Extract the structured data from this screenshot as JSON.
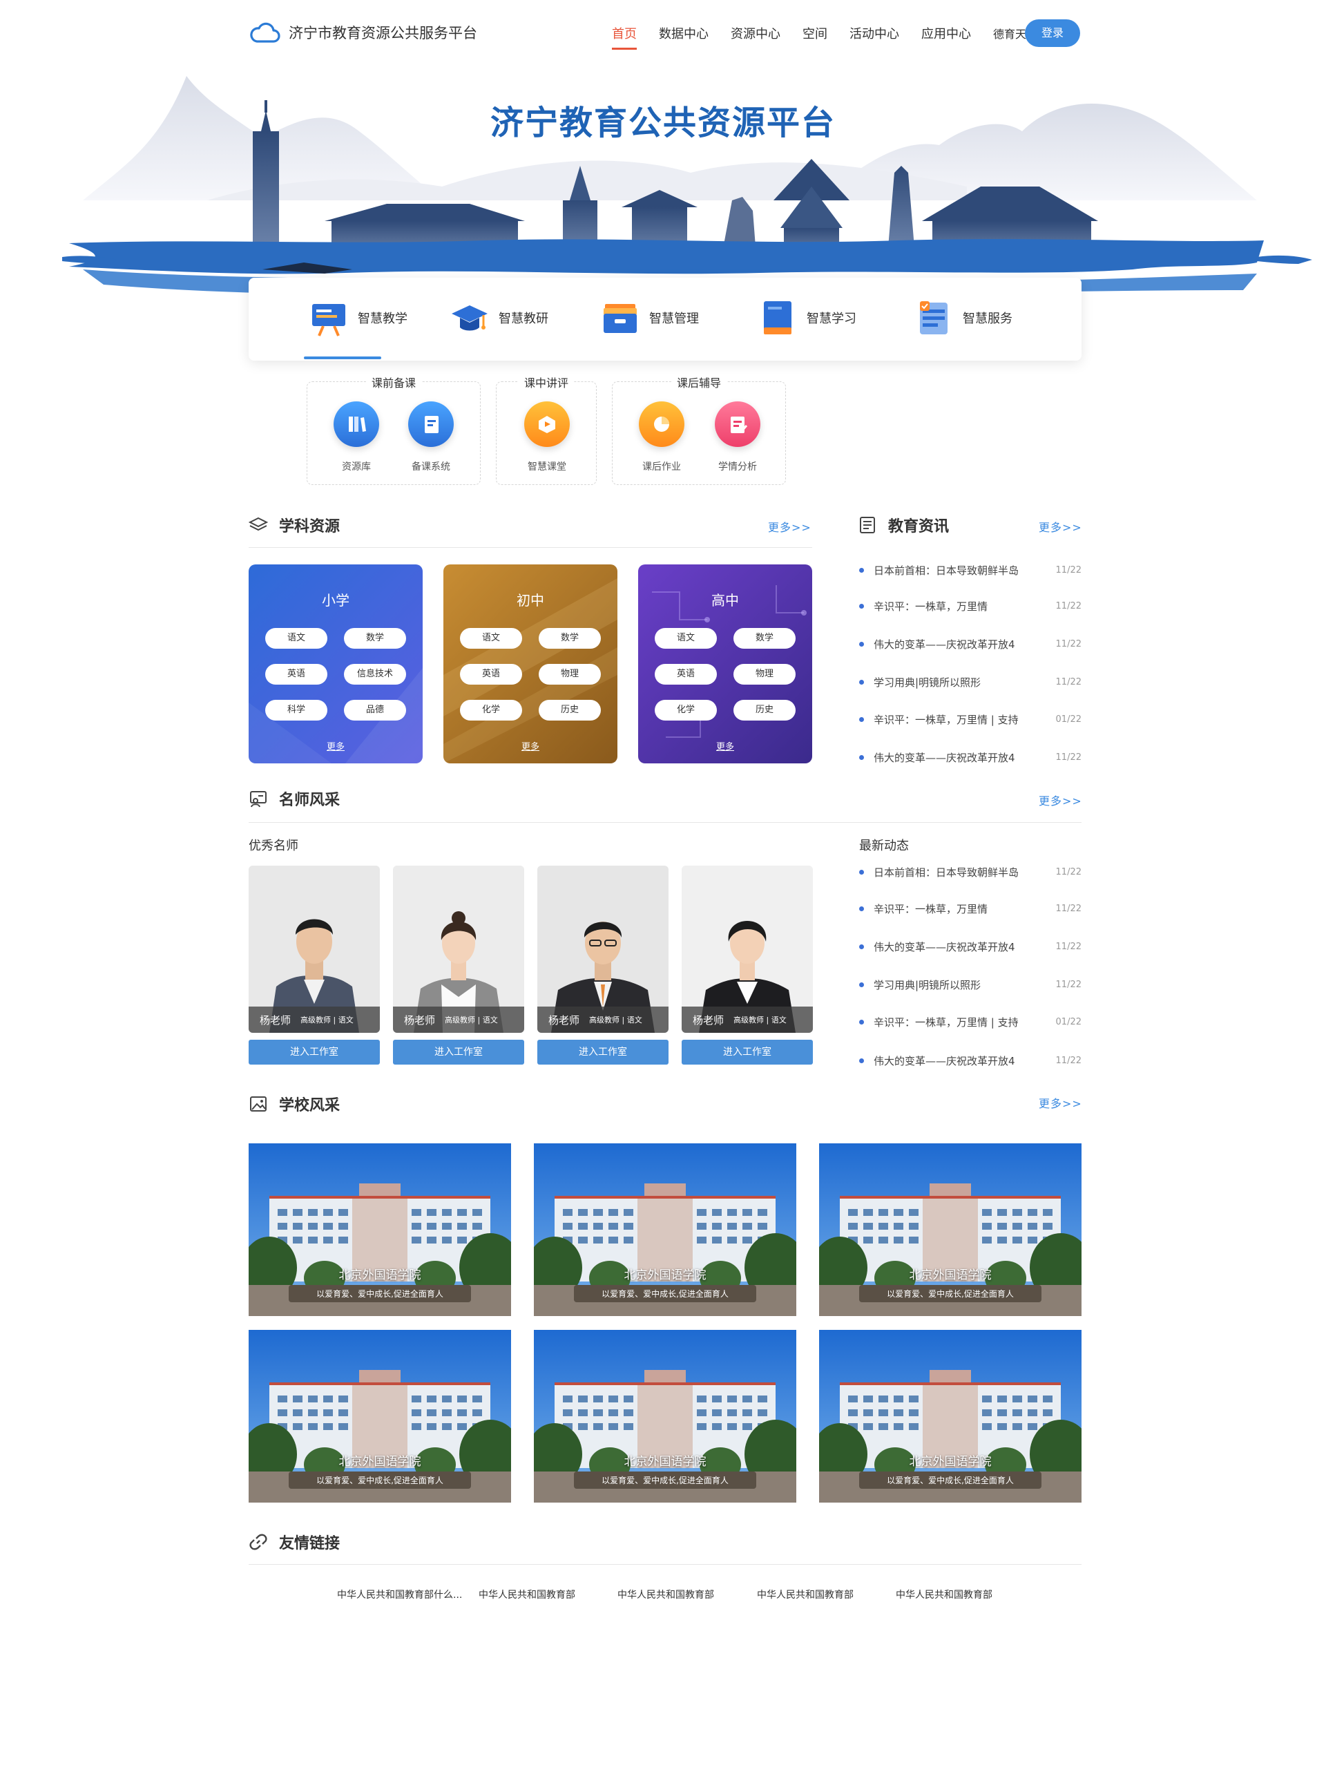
{
  "header": {
    "site_title": "济宁市教育资源公共服务平台",
    "nav": [
      "首页",
      "数据中心",
      "资源中心",
      "空间",
      "活动中心",
      "应用中心",
      "德育天地"
    ],
    "login": "登录"
  },
  "banner": {
    "title": "济宁教育公共资源平台"
  },
  "features": [
    {
      "label": "智慧教学",
      "icon": "easel-icon"
    },
    {
      "label": "智慧教研",
      "icon": "graduation-cap-icon"
    },
    {
      "label": "智慧管理",
      "icon": "briefcase-icon"
    },
    {
      "label": "智慧学习",
      "icon": "book-icon"
    },
    {
      "label": "智慧服务",
      "icon": "clipboard-icon"
    }
  ],
  "sub_features": [
    {
      "title": "课前备课",
      "items": [
        {
          "label": "资源库",
          "icon": "books-icon"
        },
        {
          "label": "备课系统",
          "icon": "notebook-icon"
        }
      ]
    },
    {
      "title": "课中讲评",
      "items": [
        {
          "label": "智慧课堂",
          "icon": "cube-icon"
        }
      ]
    },
    {
      "title": "课后辅导",
      "items": [
        {
          "label": "课后作业",
          "icon": "pie-icon"
        },
        {
          "label": "学情分析",
          "icon": "checklist-icon"
        }
      ]
    }
  ],
  "subjects": {
    "title": "学科资源",
    "more": "更多>>",
    "cards": [
      {
        "title": "小学",
        "subjects": [
          "语文",
          "数学",
          "英语",
          "信息技术",
          "科学",
          "品德"
        ],
        "more": "更多"
      },
      {
        "title": "初中",
        "subjects": [
          "语文",
          "数学",
          "英语",
          "物理",
          "化学",
          "历史"
        ],
        "more": "更多"
      },
      {
        "title": "高中",
        "subjects": [
          "语文",
          "数学",
          "英语",
          "物理",
          "化学",
          "历史"
        ],
        "more": "更多"
      }
    ]
  },
  "edu_news": {
    "title": "教育资讯",
    "more": "更多>>",
    "items": [
      {
        "text": "日本前首相：日本导致朝鲜半岛",
        "date": "11/22"
      },
      {
        "text": "辛识平：一株草，万里情",
        "date": "11/22"
      },
      {
        "text": "伟大的变革——庆祝改革开放4",
        "date": "11/22"
      },
      {
        "text": "学习用典|明镜所以照形",
        "date": "11/22"
      },
      {
        "text": "辛识平：一株草，万里情 | 支持",
        "date": "01/22"
      },
      {
        "text": "伟大的变革——庆祝改革开放4",
        "date": "11/22"
      }
    ]
  },
  "teachers": {
    "title": "名师风采",
    "more": "更多>>",
    "subtitle": "优秀名师",
    "button": "进入工作室",
    "cards": [
      {
        "name": "杨老师",
        "title": "高级教师 | 语文"
      },
      {
        "name": "杨老师",
        "title": "高级教师 | 语文"
      },
      {
        "name": "杨老师",
        "title": "高级教师 | 语文"
      },
      {
        "name": "杨老师",
        "title": "高级教师 | 语文"
      }
    ]
  },
  "latest": {
    "title": "最新动态",
    "items": [
      {
        "text": "日本前首相：日本导致朝鲜半岛",
        "date": "11/22"
      },
      {
        "text": "辛识平：一株草，万里情",
        "date": "11/22"
      },
      {
        "text": "伟大的变革——庆祝改革开放4",
        "date": "11/22"
      },
      {
        "text": "学习用典|明镜所以照形",
        "date": "11/22"
      },
      {
        "text": "辛识平：一株草，万里情 | 支持",
        "date": "01/22"
      },
      {
        "text": "伟大的变革——庆祝改革开放4",
        "date": "11/22"
      }
    ]
  },
  "schools": {
    "title": "学校风采",
    "more": "更多>>",
    "cards": [
      {
        "name": "北京外国语学院",
        "motto": "以爱育爱、爱中成长,促进全面育人"
      },
      {
        "name": "北京外国语学院",
        "motto": "以爱育爱、爱中成长,促进全面育人"
      },
      {
        "name": "北京外国语学院",
        "motto": "以爱育爱、爱中成长,促进全面育人"
      },
      {
        "name": "北京外国语学院",
        "motto": "以爱育爱、爱中成长,促进全面育人"
      },
      {
        "name": "北京外国语学院",
        "motto": "以爱育爱、爱中成长,促进全面育人"
      },
      {
        "name": "北京外国语学院",
        "motto": "以爱育爱、爱中成长,促进全面育人"
      }
    ]
  },
  "links": {
    "title": "友情链接",
    "items": [
      "中华人民共和国教育部什么...",
      "中华人民共和国教育部",
      "中华人民共和国教育部",
      "中华人民共和国教育部",
      "中华人民共和国教育部"
    ]
  },
  "colors": {
    "accent": "#3b8ae0",
    "active_nav": "#e8553a",
    "banner_blue": "#1f63b5"
  }
}
